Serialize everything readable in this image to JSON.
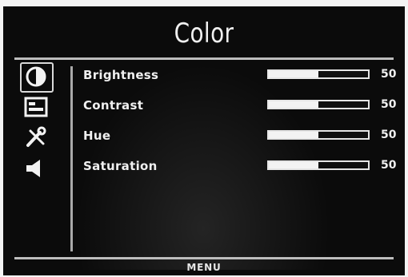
{
  "menu": {
    "title": "Color",
    "footer_hint": "MENU"
  },
  "sidebar": {
    "icons": [
      {
        "name": "color-contrast-icon",
        "selected": true
      },
      {
        "name": "picture-settings-icon",
        "selected": false
      },
      {
        "name": "tools-icon",
        "selected": false
      },
      {
        "name": "audio-speaker-icon",
        "selected": false
      }
    ]
  },
  "settings": [
    {
      "label": "Brightness",
      "value": "50",
      "level": 0.5
    },
    {
      "label": "Contrast",
      "value": "50",
      "level": 0.5
    },
    {
      "label": "Hue",
      "value": "50",
      "level": 0.5
    },
    {
      "label": "Saturation",
      "value": "50",
      "level": 0.5
    }
  ],
  "colors": {
    "background": "#0b0b0b",
    "text": "#f0f0f0",
    "bar_fill": "#f3f3f3"
  }
}
